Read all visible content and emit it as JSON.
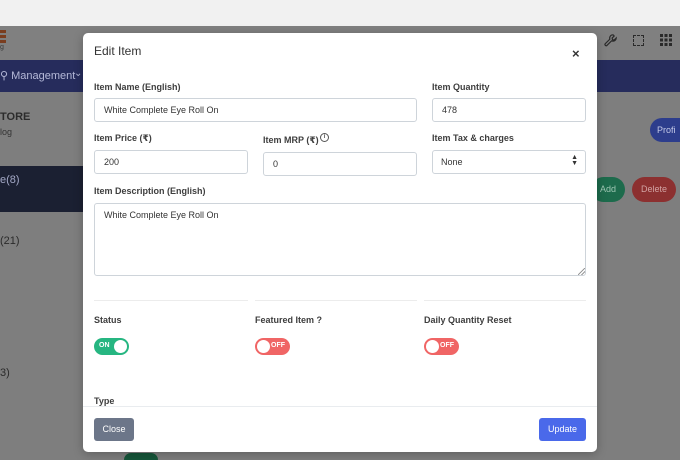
{
  "background": {
    "logo_sub": "g",
    "nav": {
      "management_label": "Management",
      "chevron": "⌄"
    },
    "store": {
      "title": "TORE",
      "subtitle": "log"
    },
    "profile_label": "Profi",
    "category_active": "e(8)",
    "category_21": "(21)",
    "category_3": "3)",
    "add_label": "Add",
    "delete_label": "Delete"
  },
  "modal": {
    "title": "Edit Item",
    "close_glyph": "×",
    "labels": {
      "item_name": "Item Name (English)",
      "item_quantity": "Item Quantity",
      "item_price": "Item Price (₹)",
      "item_mrp": "Item MRP (₹)",
      "item_tax": "Item Tax & charges",
      "item_description": "Item Description (English)",
      "status": "Status",
      "featured": "Featured Item ?",
      "daily_reset": "Daily Quantity Reset",
      "type": "Type"
    },
    "values": {
      "item_name": "White Complete Eye Roll On",
      "item_quantity": "478",
      "item_price": "200",
      "item_mrp": "0",
      "item_tax": "None",
      "item_description": "White Complete Eye Roll On"
    },
    "toggles": {
      "status": "ON",
      "featured": "OFF",
      "daily_reset": "OFF"
    },
    "info_glyph": "i",
    "buttons": {
      "close": "Close",
      "update": "Update"
    }
  },
  "colors": {
    "toggle_on": "#26b681",
    "toggle_off": "#f06565",
    "primary": "#4a69ea",
    "secondary": "#6c7689"
  }
}
